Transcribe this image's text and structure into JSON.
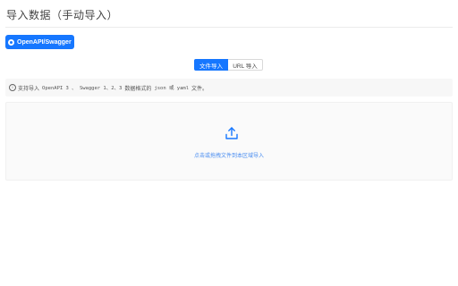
{
  "page": {
    "title": "导入数据（手动导入）"
  },
  "source_button": {
    "label": "OpenAPI/Swagger",
    "icon": "swagger-icon"
  },
  "tabs": [
    {
      "label": "文件导入",
      "active": true
    },
    {
      "label": "URL 导入",
      "active": false
    }
  ],
  "notice": {
    "icon": "info-icon",
    "prefix": "支持导入",
    "spec": "OpenAPI 3 、 Swagger 1、2、3",
    "middle": "数据格式的",
    "formats": "json 或 yaml",
    "suffix": "文件。"
  },
  "dropzone": {
    "icon": "upload-icon",
    "text": "点击或拖拽文件到本区域导入"
  },
  "colors": {
    "accent": "#1677ff",
    "link_text": "#4a8df0",
    "panel_bg": "#fafafa"
  }
}
